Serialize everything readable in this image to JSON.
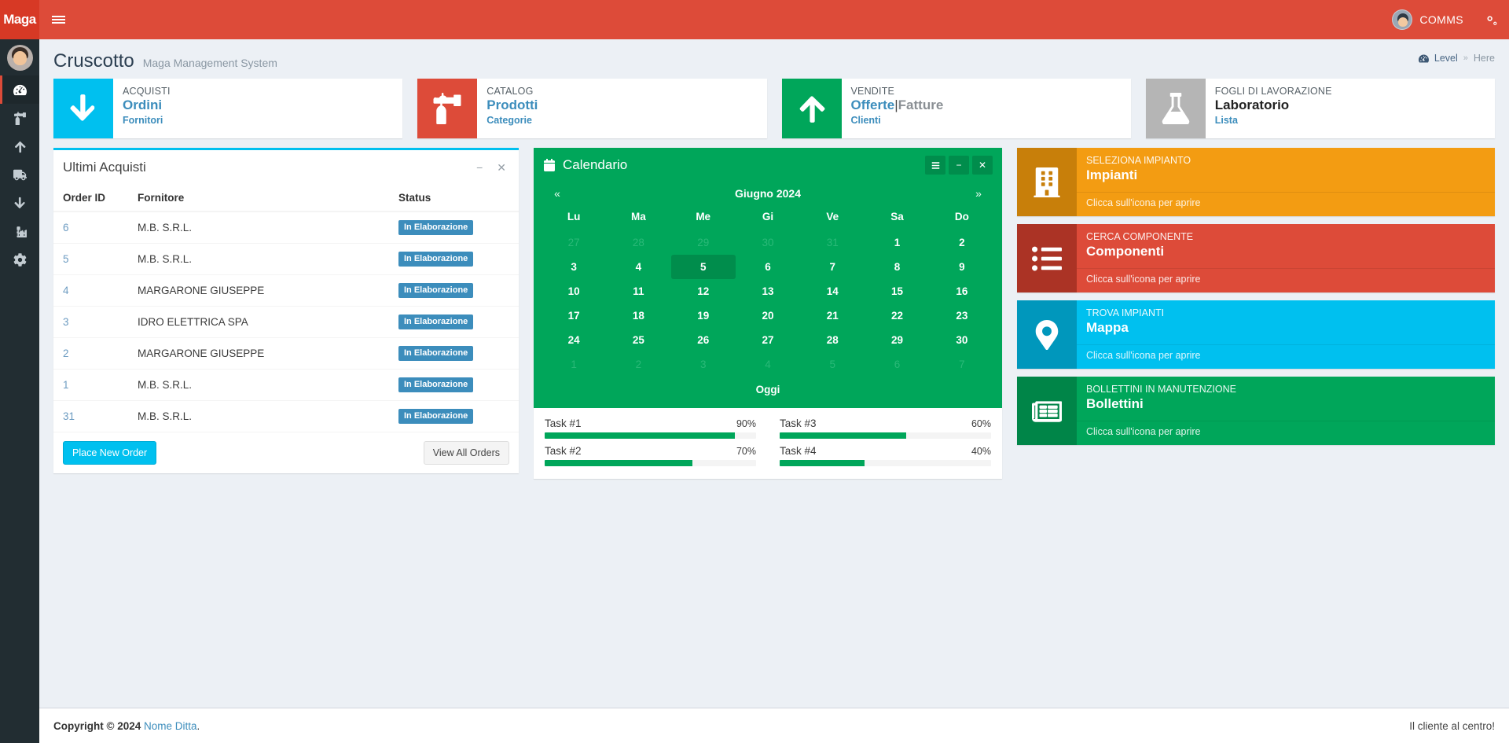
{
  "navbar": {
    "brand": "Maga",
    "menu_toggle_icon": "hamburger-icon",
    "user_name": "COMMS",
    "settings_icon": "gears-icon"
  },
  "sidebar": {
    "items": [
      {
        "name": "dashboard",
        "icon": "tachometer-icon",
        "active": true
      },
      {
        "name": "catalog",
        "icon": "fire-extinguisher-icon",
        "active": false
      },
      {
        "name": "sales",
        "icon": "arrow-up-icon",
        "active": false
      },
      {
        "name": "shipping",
        "icon": "truck-icon",
        "active": false
      },
      {
        "name": "purchases",
        "icon": "arrow-down-icon",
        "active": false
      },
      {
        "name": "reports",
        "icon": "chart-bar-icon",
        "active": false
      },
      {
        "name": "settings",
        "icon": "gear-icon",
        "active": false
      }
    ]
  },
  "page": {
    "title": "Cruscotto",
    "subtitle": "Maga Management System",
    "breadcrumb": {
      "icon": "dashboard-icon",
      "level": "Level",
      "separator": "»",
      "here": "Here"
    }
  },
  "infoboxes": [
    {
      "category": "ACQUISTI",
      "main": "Ordini",
      "sub": "Fornitori",
      "icon": "arrow-down-icon",
      "color": "#00c0ef"
    },
    {
      "category": "CATALOG",
      "main": "Prodotti",
      "sub": "Categorie",
      "icon": "fire-extinguisher-icon",
      "color": "#dd4b39"
    },
    {
      "category": "VENDITE",
      "main": "Offerte",
      "main_separator": "|",
      "main_secondary": "Fatture",
      "sub": "Clienti",
      "icon": "arrow-up-icon",
      "color": "#00a65a"
    },
    {
      "category": "FOGLI DI LAVORAZIONE",
      "main": "Laboratorio",
      "sub": "Lista",
      "icon": "flask-icon",
      "color": "#b5b5b5"
    }
  ],
  "orders_panel": {
    "title": "Ultimi Acquisti",
    "collapse_icon": "minus-icon",
    "close_icon": "close-icon",
    "columns": [
      "Order ID",
      "Fornitore",
      "Status"
    ],
    "rows": [
      {
        "order_id": "6",
        "fornitore": "M.B. S.R.L.",
        "status": "In Elaborazione"
      },
      {
        "order_id": "5",
        "fornitore": "M.B. S.R.L.",
        "status": "In Elaborazione"
      },
      {
        "order_id": "4",
        "fornitore": "MARGARONE GIUSEPPE",
        "status": "In Elaborazione"
      },
      {
        "order_id": "3",
        "fornitore": "IDRO ELETTRICA SPA",
        "status": "In Elaborazione"
      },
      {
        "order_id": "2",
        "fornitore": "MARGARONE GIUSEPPE",
        "status": "In Elaborazione"
      },
      {
        "order_id": "1",
        "fornitore": "M.B. S.R.L.",
        "status": "In Elaborazione"
      },
      {
        "order_id": "31",
        "fornitore": "M.B. S.R.L.",
        "status": "In Elaborazione"
      }
    ],
    "primary_button": "Place New Order",
    "secondary_button": "View All Orders"
  },
  "calendar": {
    "title": "Calendario",
    "icon": "calendar-icon",
    "tools": {
      "menu_icon": "bars-icon",
      "collapse_icon": "minus-icon",
      "close_icon": "close-icon"
    },
    "prev": "«",
    "next": "»",
    "month_label": "Giugno 2024",
    "day_names": [
      "Lu",
      "Ma",
      "Me",
      "Gi",
      "Ve",
      "Sa",
      "Do"
    ],
    "weeks": [
      [
        {
          "d": "27",
          "m": true
        },
        {
          "d": "28",
          "m": true
        },
        {
          "d": "29",
          "m": true
        },
        {
          "d": "30",
          "m": true
        },
        {
          "d": "31",
          "m": true
        },
        {
          "d": "1"
        },
        {
          "d": "2"
        }
      ],
      [
        {
          "d": "3"
        },
        {
          "d": "4"
        },
        {
          "d": "5",
          "today": true
        },
        {
          "d": "6"
        },
        {
          "d": "7"
        },
        {
          "d": "8"
        },
        {
          "d": "9"
        }
      ],
      [
        {
          "d": "10"
        },
        {
          "d": "11"
        },
        {
          "d": "12"
        },
        {
          "d": "13"
        },
        {
          "d": "14"
        },
        {
          "d": "15"
        },
        {
          "d": "16"
        }
      ],
      [
        {
          "d": "17"
        },
        {
          "d": "18"
        },
        {
          "d": "19"
        },
        {
          "d": "20"
        },
        {
          "d": "21"
        },
        {
          "d": "22"
        },
        {
          "d": "23"
        }
      ],
      [
        {
          "d": "24"
        },
        {
          "d": "25"
        },
        {
          "d": "26"
        },
        {
          "d": "27"
        },
        {
          "d": "28"
        },
        {
          "d": "29"
        },
        {
          "d": "30"
        }
      ],
      [
        {
          "d": "1",
          "m": true
        },
        {
          "d": "2",
          "m": true
        },
        {
          "d": "3",
          "m": true
        },
        {
          "d": "4",
          "m": true
        },
        {
          "d": "5",
          "m": true
        },
        {
          "d": "6",
          "m": true
        },
        {
          "d": "7",
          "m": true
        }
      ]
    ],
    "today_label": "Oggi"
  },
  "tasks": [
    {
      "label": "Task #1",
      "percent": "90%",
      "value": 90
    },
    {
      "label": "Task #3",
      "percent": "60%",
      "value": 60
    },
    {
      "label": "Task #2",
      "percent": "70%",
      "value": 70
    },
    {
      "label": "Task #4",
      "percent": "40%",
      "value": 40
    }
  ],
  "shortcut_boxes": [
    {
      "category": "SELEZIONA IMPIANTO",
      "title": "Impianti",
      "footer": "Clicca sull'icona per aprire",
      "icon": "building-icon",
      "color": "#f39c12",
      "icon_color": "#c87f0a"
    },
    {
      "category": "CERCA COMPONENTE",
      "title": "Componenti",
      "footer": "Clicca sull'icona per aprire",
      "icon": "list-icon",
      "color": "#dd4b39",
      "icon_color": "#ab3325"
    },
    {
      "category": "TROVA IMPIANTI",
      "title": "Mappa",
      "footer": "Clicca sull'icona per aprire",
      "icon": "map-marker-icon",
      "color": "#00c0ef",
      "icon_color": "#0097bc"
    },
    {
      "category": "BOLLETTINI IN MANUTENZIONE",
      "title": "Bollettini",
      "footer": "Clicca sull'icona per aprire",
      "icon": "newspaper-icon",
      "color": "#00a65a",
      "icon_color": "#008548"
    }
  ],
  "footer": {
    "copyright_prefix": "Copyright © 2024",
    "company": "Nome Ditta",
    "copyright_suffix": ".",
    "tagline": "Il cliente al centro!"
  }
}
